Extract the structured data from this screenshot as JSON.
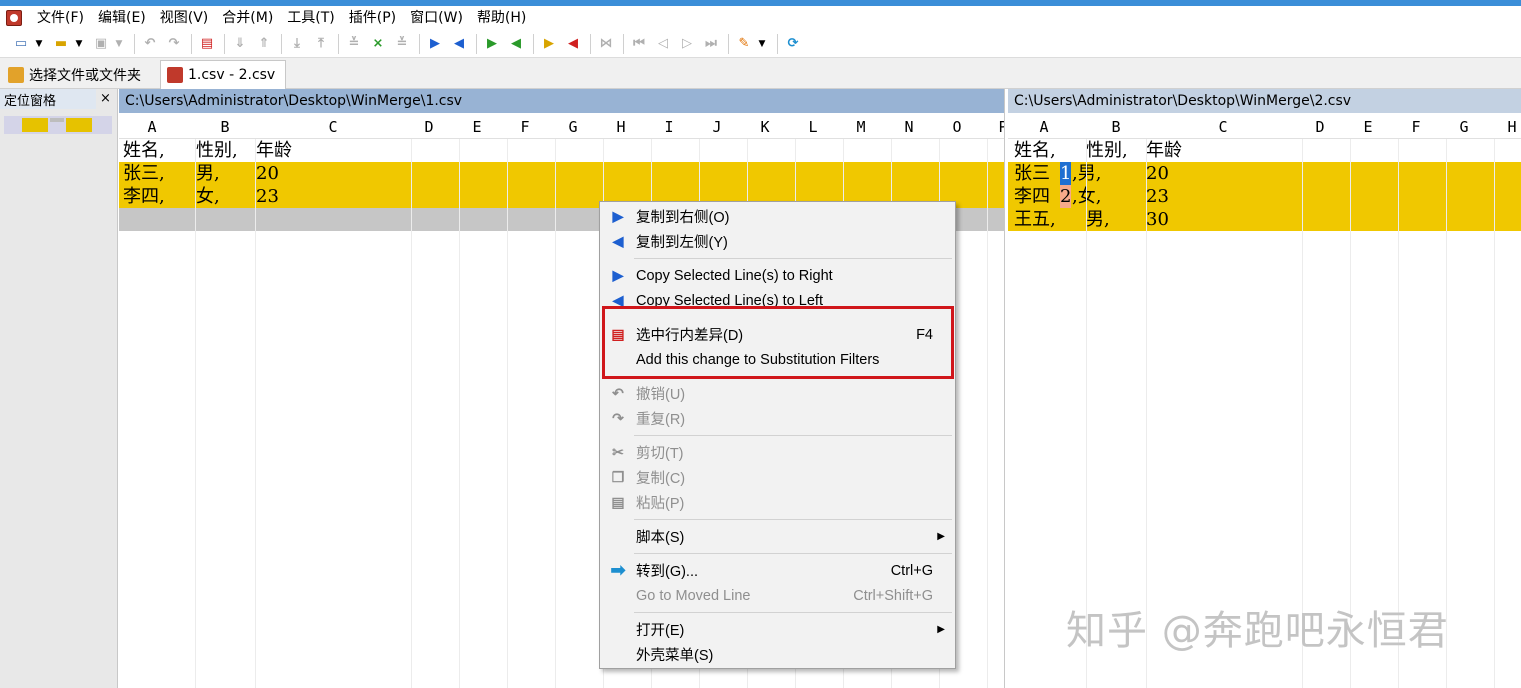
{
  "menu": [
    "文件(F)",
    "编辑(E)",
    "视图(V)",
    "合并(M)",
    "工具(T)",
    "插件(P)",
    "窗口(W)",
    "帮助(H)"
  ],
  "tabs": {
    "open": "选择文件或文件夹",
    "compare": "1.csv - 2.csv"
  },
  "location_pane": {
    "title": "定位窗格",
    "close": "×"
  },
  "left": {
    "path": "C:\\Users\\Administrator\\Desktop\\WinMerge\\1.csv",
    "columns": [
      "A",
      "B",
      "C",
      "D",
      "E",
      "F",
      "G",
      "H",
      "I",
      "J",
      "K",
      "L",
      "M",
      "N",
      "O",
      "P"
    ],
    "rows": [
      [
        "姓名,",
        "性别,",
        "年龄"
      ],
      [
        "张三,",
        "男,",
        "20"
      ],
      [
        "李四,",
        "女,",
        "23"
      ]
    ]
  },
  "right": {
    "path": "C:\\Users\\Administrator\\Desktop\\WinMerge\\2.csv",
    "columns": [
      "A",
      "B",
      "C",
      "D",
      "E",
      "F",
      "G",
      "H"
    ],
    "rows": [
      [
        "姓名,",
        "性别,",
        "年龄"
      ],
      [
        "张三",
        "1",
        ",男,",
        "20"
      ],
      [
        "李四",
        "2",
        ",女,",
        "23"
      ],
      [
        "王五,",
        "男,",
        "30"
      ]
    ]
  },
  "context_menu": {
    "copy_right": "复制到右侧(O)",
    "copy_left": "复制到左侧(Y)",
    "copy_lines_right": "Copy Selected Line(s) to Right",
    "copy_lines_left": "Copy Selected Line(s) to Left",
    "select_diff": "选中行内差异(D)",
    "select_diff_shortcut": "F4",
    "add_filter": "Add this change to Substitution Filters",
    "undo": "撤销(U)",
    "redo": "重复(R)",
    "cut": "剪切(T)",
    "copy": "复制(C)",
    "paste": "粘贴(P)",
    "scripts": "脚本(S)",
    "goto": "转到(G)...",
    "goto_shortcut": "Ctrl+G",
    "goto_moved": "Go to Moved Line",
    "goto_moved_shortcut": "Ctrl+Shift+G",
    "open": "打开(E)",
    "shell_menu": "外壳菜单(S)"
  },
  "watermark": "知乎 @奔跑吧永恒君",
  "colors": {
    "diff": "#f0c800",
    "moved": "#f7a98a",
    "selected": "#1f6fd1",
    "highlight_box": "#d0161b"
  }
}
